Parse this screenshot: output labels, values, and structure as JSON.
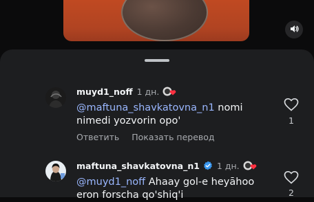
{
  "comments": [
    {
      "username": "muyd1_noff",
      "time": "1 дн.",
      "verified": false,
      "mention": "@maftuna_shavkatovna_n1",
      "text_line1": " nomi",
      "text_line2": "nimedi yozvorin opo'",
      "reply_label": "Ответить",
      "translate_label": "Показать перевод",
      "like_count": "1"
    },
    {
      "username": "maftuna_shavkatovna_n1",
      "time": "1 дн.",
      "verified": true,
      "mention": "@muyd1_noff",
      "text_line1": " Ahaay gol-e heyāhoo",
      "text_line2": "eron forscha qo'shiq'i",
      "like_count": "2"
    }
  ],
  "icons": {
    "mute": "speaker-icon",
    "like": "heart-icon",
    "verified": "verified-badge-icon",
    "reaction": "heart-reaction-icon"
  },
  "colors": {
    "sheet_bg": "#1d1e20",
    "mention": "#9ab7ff",
    "secondary_text": "#a8abaf",
    "verified": "#3897f0",
    "reaction_heart": "#ff3040"
  }
}
